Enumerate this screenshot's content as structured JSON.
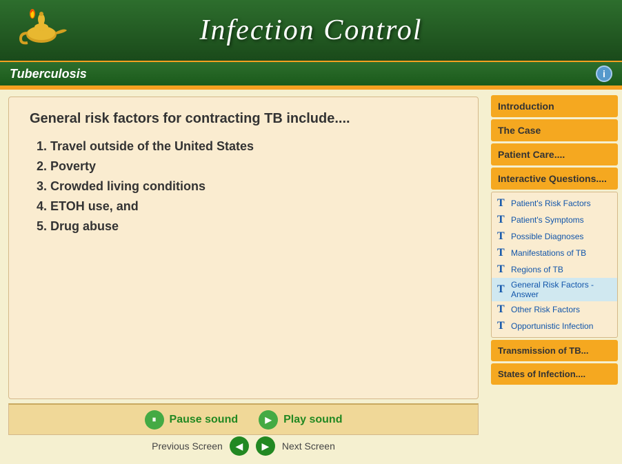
{
  "header": {
    "title": "Infection Control",
    "logo_alt": "lamp-icon"
  },
  "subheader": {
    "title": "Tuberculosis",
    "info_label": "i"
  },
  "content": {
    "heading": "General risk factors for contracting TB include....",
    "list_items": [
      "1.  Travel outside of the United States",
      "2.  Poverty",
      "3.  Crowded living conditions",
      "4.  ETOH use, and",
      "5.  Drug abuse"
    ]
  },
  "sound_bar": {
    "pause_label": "Pause sound",
    "play_label": "Play sound"
  },
  "bottom_nav": {
    "previous_label": "Previous Screen",
    "next_label": "Next Screen"
  },
  "sidebar": {
    "introduction_label": "Introduction",
    "the_case_label": "The Case",
    "patient_care_label": "Patient Care....",
    "interactive_questions_label": "Interactive Questions....",
    "sub_items": [
      {
        "label": "Patient's Risk Factors",
        "active": false
      },
      {
        "label": "Patient's Symptoms",
        "active": false
      },
      {
        "label": "Possible Diagnoses",
        "active": false
      },
      {
        "label": "Manifestations of TB",
        "active": false
      },
      {
        "label": "Regions of TB",
        "active": false
      },
      {
        "label": "General Risk Factors - Answer",
        "active": true
      },
      {
        "label": "Other Risk Factors",
        "active": false
      },
      {
        "label": "Opportunistic Infection",
        "active": false
      }
    ],
    "transmission_label": "Transmission of TB...",
    "states_label": "States of Infection...."
  }
}
